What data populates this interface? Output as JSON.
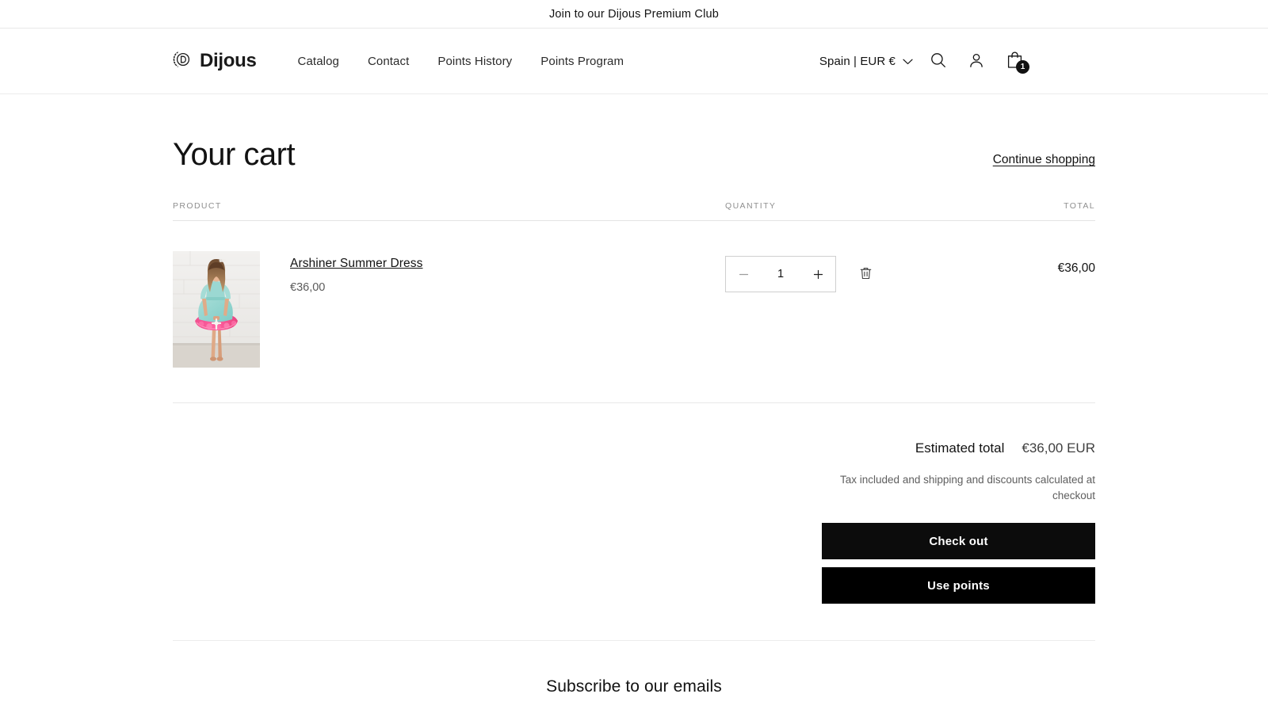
{
  "announcement": {
    "text": "Join to our Dijous Premium Club"
  },
  "header": {
    "brand": {
      "name": "Dijous",
      "mark_letter": "D",
      "icon": "laurel-wreath-d-logo"
    },
    "nav": [
      {
        "label": "Catalog"
      },
      {
        "label": "Contact"
      },
      {
        "label": "Points History"
      },
      {
        "label": "Points Program"
      }
    ],
    "locale": {
      "label": "Spain | EUR €",
      "chevron_icon": "chevron-down-icon"
    },
    "icons": {
      "search": "search-icon",
      "account": "account-icon",
      "cart": "shopping-bag-icon"
    },
    "cart_count": "1"
  },
  "cart": {
    "title": "Your cart",
    "continue_link": "Continue shopping",
    "columns": {
      "product": "PRODUCT",
      "quantity": "QUANTITY",
      "total": "TOTAL"
    },
    "items": [
      {
        "name": "Arshiner Summer Dress",
        "unit_price": "€36,00",
        "quantity": "1",
        "line_total": "€36,00",
        "image_alt": "girl-in-mint-and-pink-tutu-dress",
        "decrease_label": "−",
        "increase_label": "+",
        "remove_icon": "trash-icon"
      }
    ],
    "summary": {
      "estimated_label": "Estimated total",
      "estimated_value": "€36,00 EUR",
      "tax_note": "Tax included and shipping and discounts calculated at checkout",
      "checkout_label": "Check out",
      "points_label": "Use points"
    }
  },
  "footer": {
    "subscribe_heading": "Subscribe to our emails"
  },
  "colors": {
    "text": "#121212",
    "muted": "#5e5e5e",
    "header_label": "#8f8f8f",
    "button_bg": "#0c0c0c",
    "badge_bg": "#121212"
  }
}
